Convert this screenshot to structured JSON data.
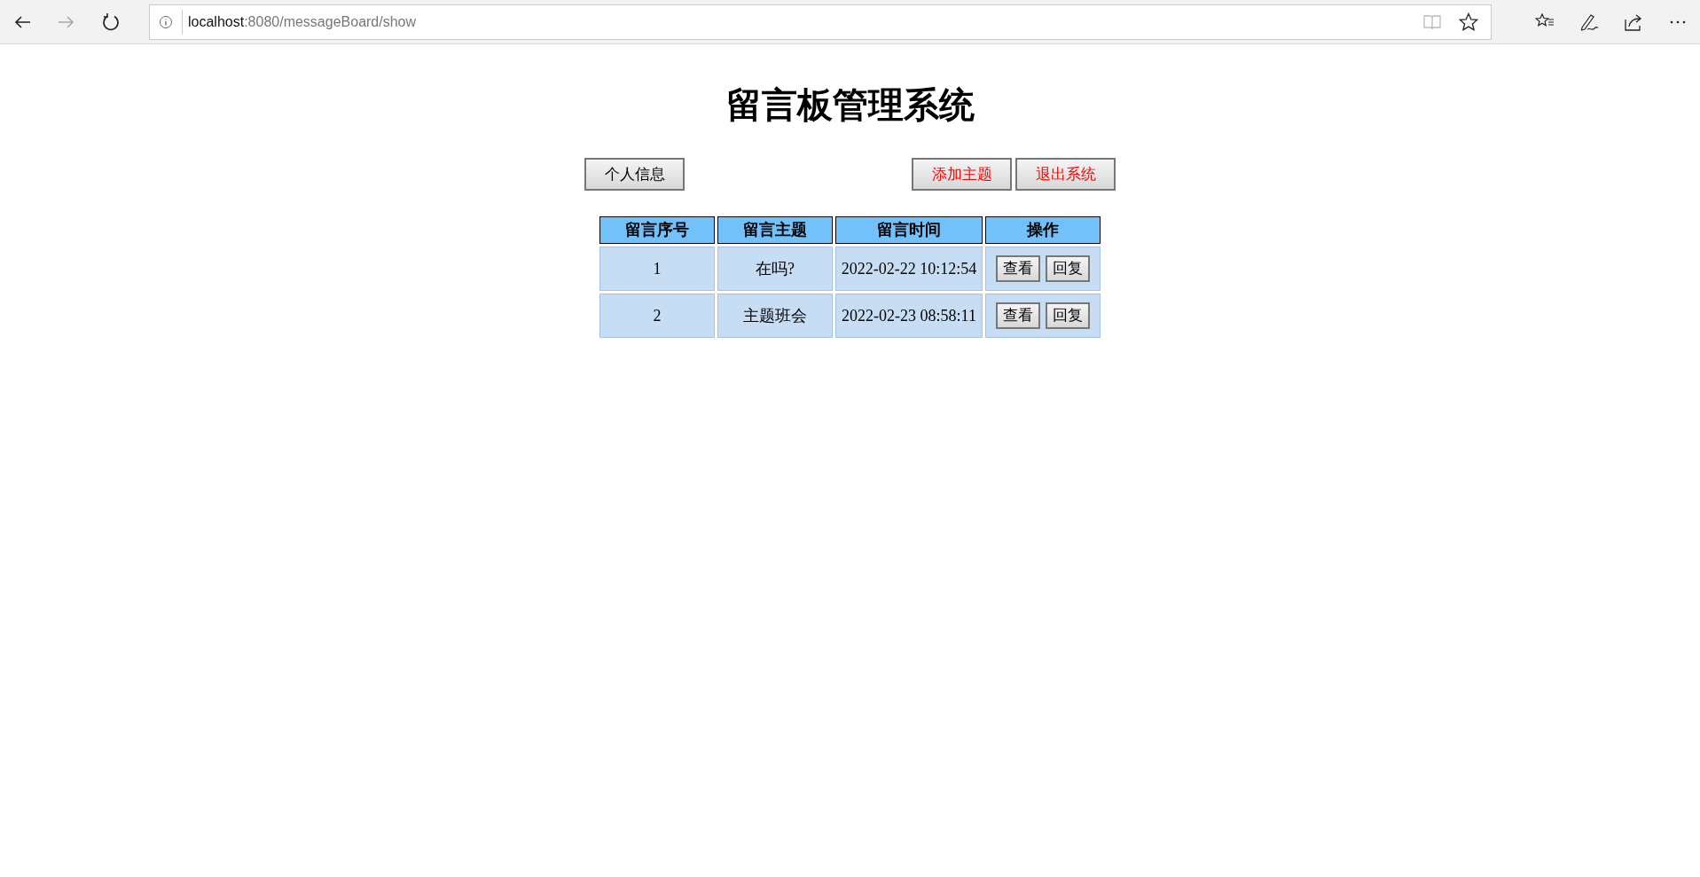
{
  "browser": {
    "nav_buttons": [
      {
        "kind": "back",
        "disabled": false
      },
      {
        "kind": "forward",
        "disabled": true
      },
      {
        "kind": "reload",
        "disabled": false
      }
    ],
    "url": {
      "host": "localhost",
      "rest": ":8080/messageBoard/show"
    }
  },
  "page": {
    "title": "留言板管理系统",
    "left_buttons": [
      {
        "label": "个人信息",
        "color": "#000000"
      }
    ],
    "right_buttons": [
      {
        "label": "添加主题",
        "color": "#ff0000"
      },
      {
        "label": "退出系统",
        "color": "#ff0000"
      }
    ],
    "table": {
      "columns": [
        "留言序号",
        "留言主题",
        "留言时间",
        "操作"
      ],
      "rows": [
        {
          "id": "1",
          "subject": "在吗?",
          "time": "2022-02-22 10:12:54",
          "actions": [
            "查看",
            "回复"
          ]
        },
        {
          "id": "2",
          "subject": "主题班会",
          "time": "2022-02-23 08:58:11",
          "actions": [
            "查看",
            "回复"
          ]
        }
      ]
    }
  }
}
